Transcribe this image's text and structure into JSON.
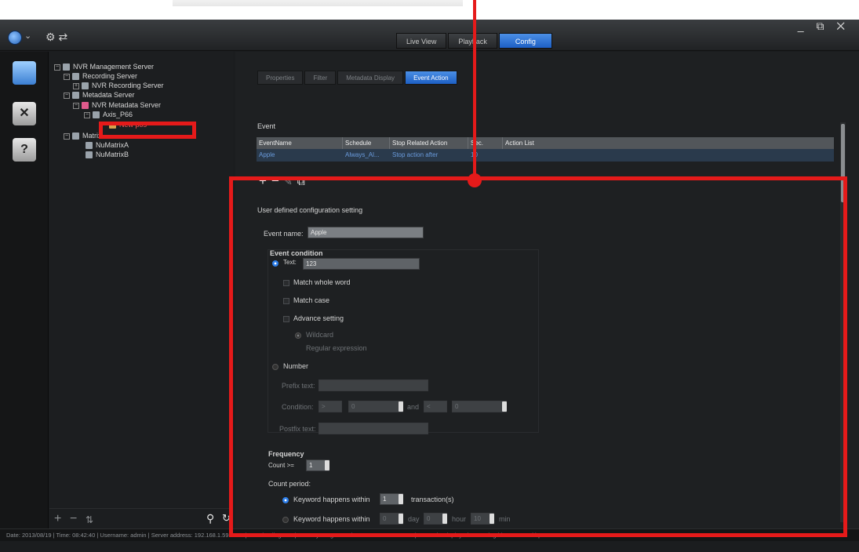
{
  "topbar": {
    "tabs": [
      "Live View",
      "Playback",
      "Config"
    ],
    "active_tab": "Config",
    "window_controls": "_ ⧉ ✕"
  },
  "tree": {
    "nodes": [
      {
        "label": "NVR Management Server"
      },
      {
        "label": "Recording Server"
      },
      {
        "label": "NVR Recording Server"
      },
      {
        "label": "Metadata Server"
      },
      {
        "label": "NVR Metadata Server"
      },
      {
        "label": "Axis_P66"
      },
      {
        "label": "New pos"
      },
      {
        "label": "Matrix"
      },
      {
        "label": "NuMatrixA"
      },
      {
        "label": "NuMatrixB"
      }
    ]
  },
  "subtabs": [
    "Properties",
    "Filter",
    "Metadata Display",
    "Event Action"
  ],
  "event_section": {
    "title": "Event",
    "columns": [
      "EventName",
      "Schedule",
      "Stop Related Action",
      "Sec.",
      "Action List"
    ],
    "rows": [
      {
        "name": "Apple",
        "schedule": "Always_Al...",
        "stop_action": "Stop action after",
        "sec": "10",
        "action_list": ""
      }
    ]
  },
  "config": {
    "title": "User defined configuration setting",
    "event_name_label": "Event name:",
    "event_name_value": "Apple",
    "event_condition_label": "Event condition",
    "text_label": "Text:",
    "text_value": "123",
    "match_whole_word": "Match whole word",
    "match_case": "Match case",
    "advance_setting": "Advance setting",
    "wildcard": "Wildcard",
    "regular_expression": "Regular expression",
    "number_label": "Number",
    "prefix_label": "Prefix text:",
    "condition_label": "Condition:",
    "condition_op1": ">",
    "condition_val1": "0",
    "and_label": "and",
    "condition_op2": "<",
    "condition_val2": "0",
    "postfix_label": "Postfix text:",
    "frequency_label": "Frequency",
    "count_label": "Count >=",
    "count_value": "1",
    "count_period_label": "Count period:",
    "kw1_label": "Keyword happens within",
    "kw1_value": "1",
    "kw1_unit": "transaction(s)",
    "kw2_label": "Keyword happens within",
    "kw2_day_value": "0",
    "kw2_day_unit": "day",
    "kw2_hour_value": "0",
    "kw2_hour_unit": "hour",
    "kw2_min_value": "10",
    "kw2_min_unit": "min"
  },
  "status_bar": "Date: 2013/08/19 | Time: 08:42:40 | Username: admin | Server address: 192.168.1.59:5250 | CPU loading: 0% | Memory usage: Total 8128MB Free 7171MB | Network: Displayed streaming bit rate: 0.00 kbps",
  "colors": {
    "annotation_red": "#e51a1a",
    "accent_blue": "#2c7de8"
  }
}
